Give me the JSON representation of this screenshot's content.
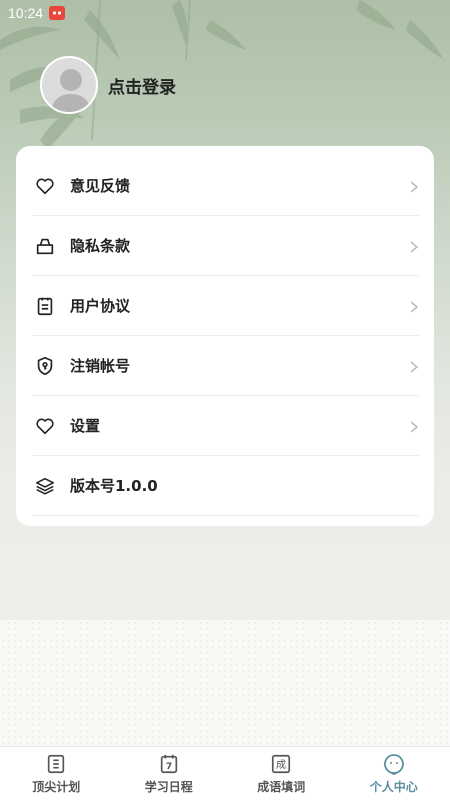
{
  "status_bar": {
    "time": "10:24"
  },
  "profile": {
    "login_text": "点击登录"
  },
  "menu": [
    {
      "label": "意见反馈",
      "icon": "heart-icon",
      "has_chevron": true
    },
    {
      "label": "隐私条款",
      "icon": "bag-icon",
      "has_chevron": true
    },
    {
      "label": "用户协议",
      "icon": "clipboard-icon",
      "has_chevron": true
    },
    {
      "label": "注销帐号",
      "icon": "shield-icon",
      "has_chevron": true
    },
    {
      "label": "设置",
      "icon": "heart-icon",
      "has_chevron": true
    },
    {
      "label": "版本号1.0.0",
      "icon": "layers-icon",
      "has_chevron": false
    }
  ],
  "tabs": [
    {
      "label": "顶尖计划",
      "icon": "list-icon",
      "active": false
    },
    {
      "label": "学习日程",
      "icon": "calendar-icon",
      "icon_glyph": "7",
      "active": false
    },
    {
      "label": "成语填词",
      "icon": "idiom-icon",
      "icon_glyph": "成",
      "active": false
    },
    {
      "label": "个人中心",
      "icon": "smiley-icon",
      "active": true
    }
  ],
  "colors": {
    "active_tab": "#5b8fa0",
    "header_green": "#aebfa8"
  }
}
